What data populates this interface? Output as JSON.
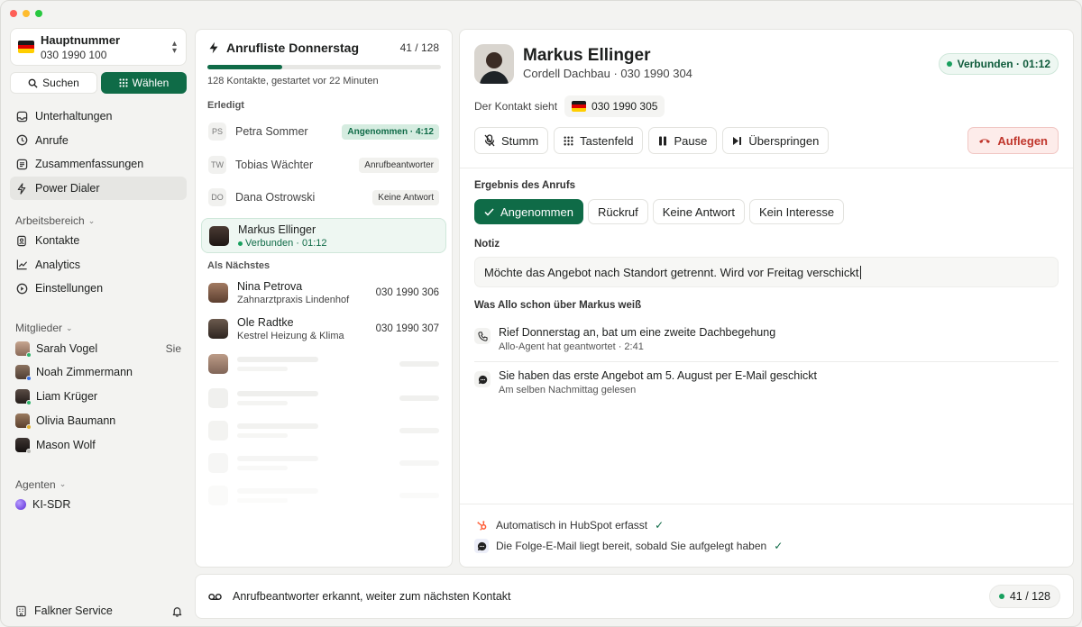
{
  "window": {
    "traffic_lights": [
      "close",
      "minimize",
      "maximize"
    ]
  },
  "account": {
    "name": "Hauptnummer",
    "number": "030 1990 100",
    "flag": "de-flag"
  },
  "segment": {
    "search_label": "Suchen",
    "dial_label": "Wählen"
  },
  "nav": [
    {
      "label": "Unterhaltungen",
      "icon": "inbox-icon"
    },
    {
      "label": "Anrufe",
      "icon": "clock-icon"
    },
    {
      "label": "Zusammenfassungen",
      "icon": "list-icon"
    },
    {
      "label": "Power Dialer",
      "icon": "bolt-icon",
      "active": true
    }
  ],
  "workspace": {
    "title": "Arbeitsbereich",
    "items": [
      {
        "label": "Kontakte",
        "icon": "contacts-icon"
      },
      {
        "label": "Analytics",
        "icon": "chart-icon"
      },
      {
        "label": "Einstellungen",
        "icon": "settings-icon"
      }
    ]
  },
  "members": {
    "title": "Mitglieder",
    "items": [
      {
        "name": "Sarah Vogel",
        "tag": "Sie",
        "status": "#2fb36b",
        "avatar": "#b08c76"
      },
      {
        "name": "Noah Zimmermann",
        "status": "#3b6fe0",
        "avatar": "#6b5546"
      },
      {
        "name": "Liam Krüger",
        "status": "#2fb36b",
        "avatar": "#3d3430"
      },
      {
        "name": "Olivia Baumann",
        "status": "#e0b030",
        "avatar": "#7a5c44"
      },
      {
        "name": "Mason Wolf",
        "status": "#b8b8b4",
        "avatar": "#2b2624"
      }
    ]
  },
  "agents": {
    "title": "Agenten",
    "items": [
      {
        "name": "KI-SDR"
      }
    ]
  },
  "footer": {
    "company": "Falkner Service"
  },
  "calllist": {
    "title": "Anrufliste Donnerstag",
    "count": "41 / 128",
    "progress": 0.32,
    "subtitle": "128 Kontakte, gestartet vor 22 Minuten",
    "done_label": "Erledigt",
    "done": [
      {
        "initials": "PS",
        "name": "Petra Sommer",
        "badge": "Angenommen · 4:12",
        "green": true
      },
      {
        "initials": "TW",
        "name": "Tobias Wächter",
        "badge": "Anrufbeantworter",
        "green": false
      },
      {
        "initials": "DO",
        "name": "Dana Ostrowski",
        "badge": "Keine Antwort",
        "green": false
      }
    ],
    "current": {
      "name": "Markus Ellinger",
      "status": "Verbunden · 01:12"
    },
    "next_label": "Als Nächstes",
    "next": [
      {
        "name": "Nina Petrova",
        "company": "Zahnarztpraxis Lindenhof",
        "phone": "030 1990 306"
      },
      {
        "name": "Ole Radtke",
        "company": "Kestrel Heizung & Klima",
        "phone": "030 1990 307"
      }
    ]
  },
  "call": {
    "name": "Markus Ellinger",
    "subtitle": "Cordell Dachbau · 030 1990 304",
    "status": "Verbunden · 01:12",
    "sees_label": "Der Kontakt sieht",
    "sees_number": "030 1990 305",
    "controls": {
      "mute": "Stumm",
      "keypad": "Tastenfeld",
      "pause": "Pause",
      "skip": "Überspringen",
      "hangup": "Auflegen"
    },
    "result_label": "Ergebnis des Anrufs",
    "results": [
      "Angenommen",
      "Rückruf",
      "Keine Antwort",
      "Kein Interesse"
    ],
    "note_label": "Notiz",
    "note_value": "Möchte das Angebot nach Standort getrennt. Wird vor Freitag verschickt",
    "knows_label": "Was Allo schon über Markus weiß",
    "knows": [
      {
        "title": "Rief Donnerstag an, bat um eine zweite Dachbegehung",
        "sub": "Allo-Agent hat geantwortet · 2:41",
        "icon": "phone-icon"
      },
      {
        "title": "Sie haben das erste Angebot am 5. August per E-Mail geschickt",
        "sub": "Am selben Nachmittag gelesen",
        "icon": "message-icon"
      }
    ],
    "footer": [
      {
        "text": "Automatisch in HubSpot erfasst",
        "icon": "hubspot-icon"
      },
      {
        "text": "Die Folge-E-Mail liegt bereit, sobald Sie aufgelegt haben",
        "icon": "message-icon"
      }
    ]
  },
  "bottom": {
    "text": "Anrufbeantworter erkannt, weiter zum nächsten Kontakt",
    "count": "41 / 128"
  }
}
